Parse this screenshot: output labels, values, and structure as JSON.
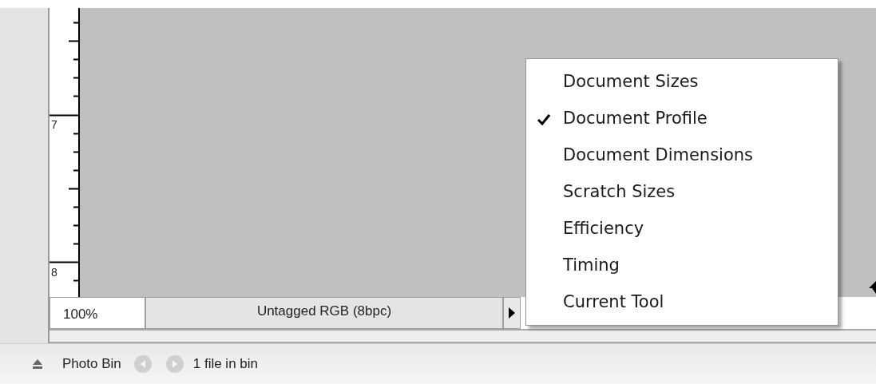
{
  "ruler": {
    "labels": [
      "7",
      "8"
    ]
  },
  "status_bar": {
    "zoom": "100%",
    "info": "Untagged RGB (8bpc)"
  },
  "menu": {
    "items": [
      {
        "label": "Document Sizes",
        "checked": false
      },
      {
        "label": "Document Profile",
        "checked": true
      },
      {
        "label": "Document Dimensions",
        "checked": false
      },
      {
        "label": "Scratch Sizes",
        "checked": false
      },
      {
        "label": "Efficiency",
        "checked": false
      },
      {
        "label": "Timing",
        "checked": false
      },
      {
        "label": "Current Tool",
        "checked": false
      }
    ]
  },
  "photo_bin": {
    "title": "Photo Bin",
    "back_disabled": true,
    "forward_disabled": true,
    "count": "1 file in bin"
  }
}
